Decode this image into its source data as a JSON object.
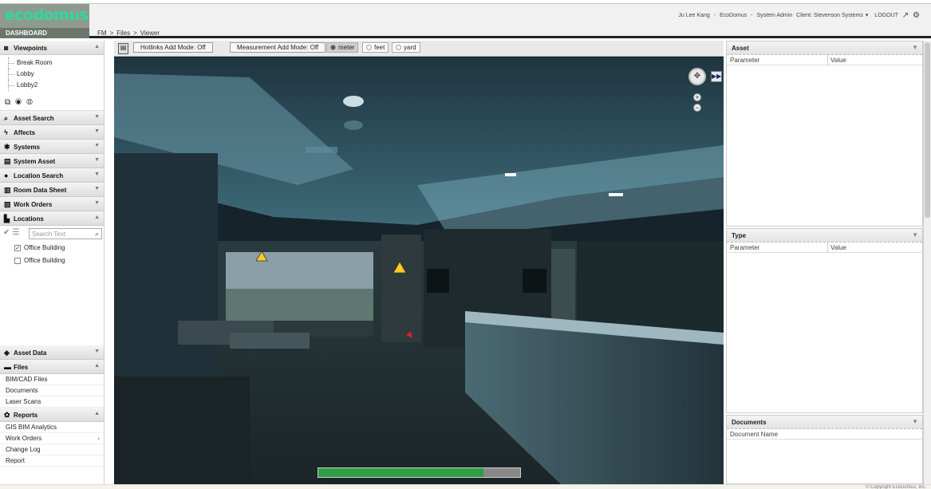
{
  "app": {
    "logo": "ecodomus",
    "dashboard_label": "DASHBOARD"
  },
  "breadcrumb": [
    "FM",
    ">",
    "Files",
    ">",
    "Viewer"
  ],
  "user": {
    "name": "Ju Lee Kang",
    "sep1": "-",
    "company": "EcoDomus",
    "sep2": "-",
    "role": "System Admin",
    "client": "Client: Stevenson Systems",
    "logout": "LOGOUT"
  },
  "sidebar": {
    "viewpoints": {
      "title": "Viewpoints",
      "items": [
        "Break Room",
        "Lobby",
        "Lobby2"
      ]
    },
    "viewpoint_icons": [
      "camera-add-icon",
      "camera-icon",
      "camera-delete-icon"
    ],
    "sections": [
      {
        "label": "Asset Search",
        "icon": "asset-search-icon"
      },
      {
        "label": "Affects",
        "icon": "bolt-icon"
      },
      {
        "label": "Systems",
        "icon": "systems-icon"
      },
      {
        "label": "System Asset",
        "icon": "document-icon"
      },
      {
        "label": "Location Search",
        "icon": "pin-icon"
      },
      {
        "label": "Room Data Sheet",
        "icon": "sheet-icon"
      },
      {
        "label": "Work Orders",
        "icon": "work-order-icon"
      }
    ],
    "locations": {
      "title": "Locations",
      "search_placeholder": "Search Text",
      "items": [
        {
          "label": "Office Building",
          "checked": true
        },
        {
          "label": "Office Building",
          "checked": false
        }
      ]
    },
    "asset_data": "Asset Data",
    "files": {
      "title": "Files",
      "items": [
        "BIM/CAD Files",
        "Documents",
        "Laser Scans"
      ]
    },
    "reports": {
      "title": "Reports",
      "items": [
        "GIS BIM Analytics",
        "Work Orders",
        "Change Log",
        "Report"
      ]
    }
  },
  "viewer": {
    "hotlinks": "Hotlinks Add Mode: Off",
    "measurement": "Measurement Add Mode: Off",
    "units": [
      "meter",
      "feet",
      "yard"
    ],
    "selected_unit": "meter",
    "load_progress": 0.82
  },
  "panels": {
    "asset": {
      "title": "Asset",
      "col1": "Parameter",
      "col2": "Value"
    },
    "type": {
      "title": "Type",
      "col1": "Parameter",
      "col2": "Value"
    },
    "documents": {
      "title": "Documents",
      "col1": "Document Name"
    }
  },
  "footer": "© Copyright EcoDomus, Inc."
}
